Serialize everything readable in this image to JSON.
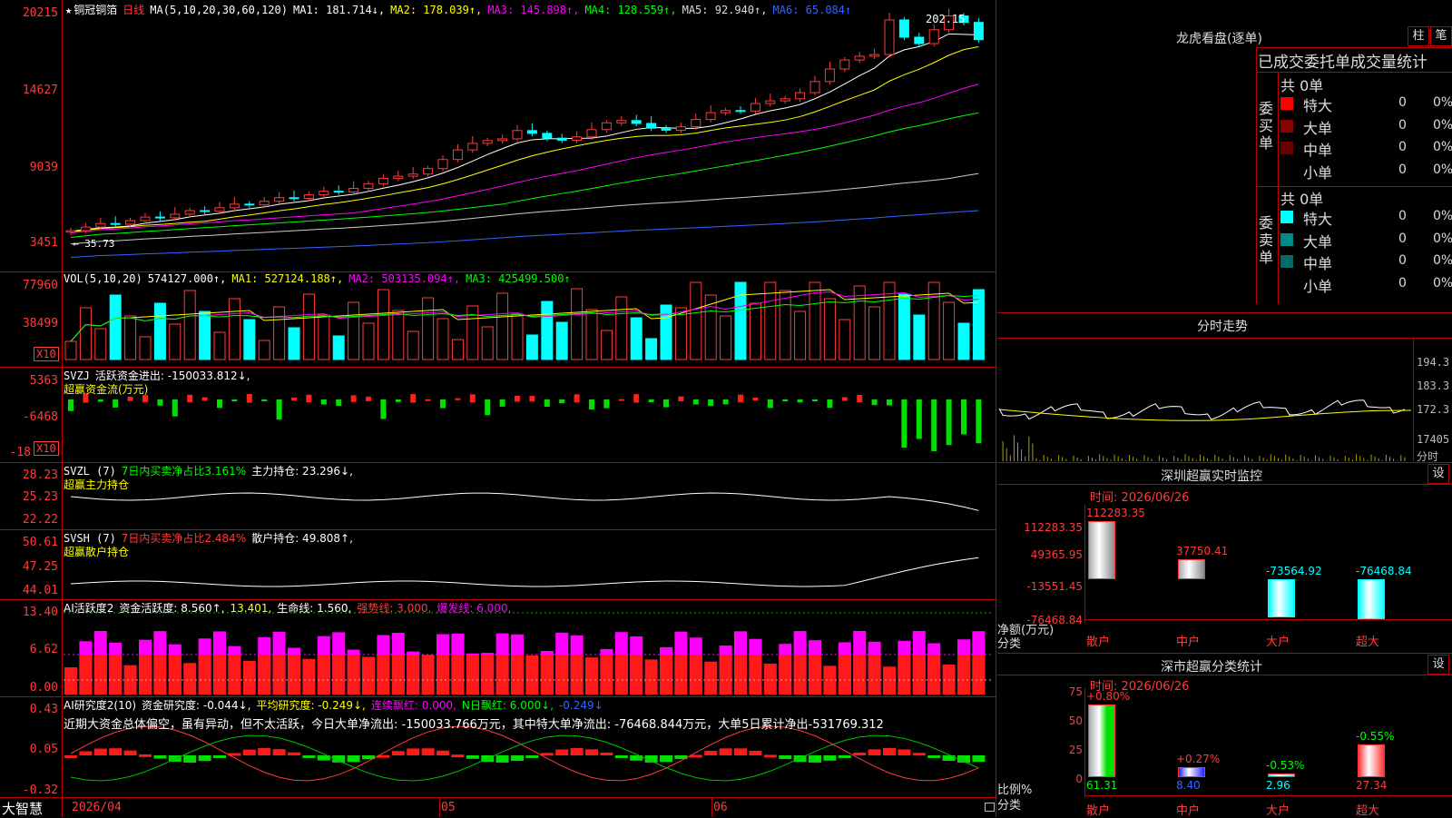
{
  "left_axis": {
    "main": [
      "20215",
      "14627",
      "9039",
      "3451"
    ],
    "vol": [
      "77960",
      "38499"
    ],
    "vol_unit": "X10",
    "svzj": [
      "5363",
      "-6468",
      "-18"
    ],
    "svzj_unit": "X10",
    "svzl": [
      "28.23",
      "25.23",
      "22.22"
    ],
    "svsh": [
      "50.61",
      "47.25",
      "44.01"
    ],
    "ai_active": [
      "13.40",
      "6.62",
      "0.00"
    ],
    "ai_research": [
      "0.43",
      "0.05",
      "-0.32"
    ]
  },
  "main_header": {
    "star": "★",
    "name": "铜冠铜箔",
    "period": "日线",
    "ma_params": "MA(5,10,20,30,60,120)",
    "ma1": "MA1: 181.714↓,",
    "ma2": "MA2: 178.039↑,",
    "ma3": "MA3: 145.898↑,",
    "ma4": "MA4: 128.559↑,",
    "ma5": "MA5: 92.940↑,",
    "ma6": "MA6: 65.084↑",
    "high_mark": "202.15",
    "low_mark": "35.73"
  },
  "vol_header": {
    "label": "VOL(5,10,20)",
    "value": "574127.000↑,",
    "ma1": "MA1: 527124.188↑,",
    "ma2": "MA2: 503135.094↑,",
    "ma3": "MA3: 425499.500↑"
  },
  "svzj_header": {
    "label": "SVZJ",
    "text": "活跃资金进出: -150033.812↓,",
    "sub": "超赢资金流(万元)"
  },
  "svzl_header": {
    "label": "SVZL (7)",
    "ratio": "7日内买卖净占比3.161%",
    "hold": "主力持仓: 23.296↓,",
    "sub": "超赢主力持仓"
  },
  "svsh_header": {
    "label": "SVSH (7)",
    "ratio": "7日内买卖净占比2.484%",
    "hold": "散户持仓: 49.808↑,",
    "sub": "超赢散户持仓"
  },
  "ai_active_header": {
    "label": "AI活跃度2",
    "fund": "资金活跃度: 8.560↑,",
    "v2": "13.401,",
    "life": "生命线: 1.560,",
    "strong": "强势线: 3.000,",
    "burst": "爆发线: 6.000,"
  },
  "ai_research_header": {
    "label": "AI研究度2(10)",
    "fund": "资金研究度: -0.044↓,",
    "avg": "平均研究度: -0.249↓,",
    "red": "连续飘红: 0.000,",
    "nred": "N日飘红: 6.000↓,",
    "last": "-0.249↓"
  },
  "commentary": "近期大资金总体偏空，虽有异动，但不太活跃，今日大单净流出: -150033.766万元，其中特大单净流出: -76468.844万元，大单5日累计净出-531769.312",
  "date_axis": {
    "start": "2026/04",
    "m5": "05",
    "m6": "06",
    "brand": "大智慧"
  },
  "dragon_tiger": {
    "title": "龙虎看盘(逐单)",
    "btn1": "柱",
    "btn2": "笔",
    "subtitle": "已成交委托单成交量统计",
    "buy_label": "委买单",
    "sell_label": "委卖单",
    "buy_total": "共 0单",
    "sell_total": "共 0单",
    "buy_rows": [
      {
        "name": "特大",
        "count": "0",
        "pct": "0%",
        "color": "#ff0000"
      },
      {
        "name": "大单",
        "count": "0",
        "pct": "0%",
        "color": "#8b0000"
      },
      {
        "name": "中单",
        "count": "0",
        "pct": "0%",
        "color": "#6b0000"
      },
      {
        "name": "小单",
        "count": "0",
        "pct": "0%",
        "color": "#000000"
      }
    ],
    "sell_rows": [
      {
        "name": "特大",
        "count": "0",
        "pct": "0%",
        "color": "#00ffff"
      },
      {
        "name": "大单",
        "count": "0",
        "pct": "0%",
        "color": "#008b8b"
      },
      {
        "name": "中单",
        "count": "0",
        "pct": "0%",
        "color": "#006b6b"
      },
      {
        "name": "小单",
        "count": "0",
        "pct": "0%",
        "color": "#000000"
      }
    ]
  },
  "intraday": {
    "title": "分时走势",
    "labels": [
      "194.3",
      "183.3",
      "172.3",
      "17405"
    ],
    "unit": "分时"
  },
  "sz_monitor": {
    "title": "深圳超赢实时监控",
    "btn": "设",
    "time": "时间: 2026/06/26",
    "yaxis": [
      "112283.35",
      "49365.95",
      "-13551.45",
      "-76468.84"
    ],
    "ylabel": "净额(万元)",
    "xlabel": "分类",
    "categories": [
      "散户",
      "中户",
      "大户",
      "超大"
    ],
    "values": [
      "112283.35",
      "37750.41",
      "-73564.92",
      "-76468.84"
    ]
  },
  "sz_category": {
    "title": "深市超赢分类统计",
    "btn": "设",
    "time": "时间: 2026/06/26",
    "yaxis": [
      "75",
      "50",
      "25",
      "0"
    ],
    "ylabel": "比例%",
    "xlabel": "分类",
    "categories": [
      "散户",
      "中户",
      "大户",
      "超大"
    ],
    "change": [
      "+0.80%",
      "+0.27%",
      "-0.53%",
      "-0.55%"
    ],
    "values": [
      "61.31",
      "8.40",
      "2.96",
      "27.34"
    ]
  }
}
